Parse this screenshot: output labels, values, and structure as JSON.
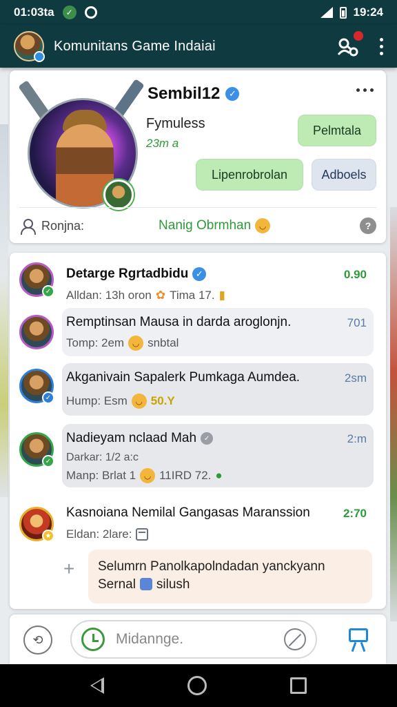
{
  "statusbar": {
    "time": "01:03ta",
    "clock": "19:24"
  },
  "appbar": {
    "title": "Komunitans Game Indaiai"
  },
  "profile": {
    "name": "Sembil12",
    "status": "Fymuless",
    "status_sub": "23m a",
    "btn_top": "Pelmtala",
    "btn_primary": "Lipenrobrolan",
    "btn_secondary": "Adboels",
    "role_label": "Ronjna:",
    "now_label": "Nanig Obrmhan"
  },
  "chats": [
    {
      "title": "Detarge Rgrtadbidu",
      "sub": "Alldan: 13h oron",
      "sub2": "Tima 17.",
      "time": "0.90"
    },
    {
      "title": "Remptinsan Mausa in darda aroglonjn.",
      "sub": "Tomp: 2em",
      "sub2": "snbtal",
      "time": "701"
    },
    {
      "title": "Akganivain Sapalerk Pumkaga Aumdea.",
      "sub": "Hump: Esm",
      "sub2": "50.Y",
      "time": "2sm"
    },
    {
      "title": "Nadieyam nclaad Mah",
      "sub": "Darkar: 1/2 a:c",
      "sub2_a": "Manp: Brlat 1",
      "sub2_b": "11IRD 72.",
      "time": "2:m"
    },
    {
      "title": "Kasnoiana Nemilal Gangasas Maranssion",
      "sub": "Eldan: 2lare:",
      "time": "2:70"
    }
  ],
  "reply": {
    "line1": "Selumrn Panolkapolndadan yanckyann",
    "line2": "Sernal",
    "line2_b": "silush"
  },
  "input": {
    "placeholder": "Midannge."
  }
}
